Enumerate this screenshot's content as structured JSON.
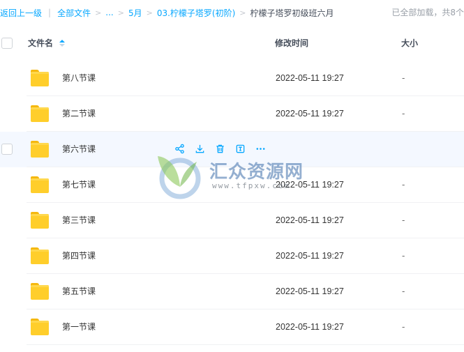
{
  "breadcrumb": {
    "back": "返回上一级",
    "items": [
      "全部文件",
      "...",
      "5月",
      "03.柠檬子塔罗(初阶)"
    ],
    "current": "柠檬子塔罗初级班六月",
    "status": "已全部加载，共8个"
  },
  "table": {
    "headers": {
      "name": "文件名",
      "time": "修改时间",
      "size": "大小"
    },
    "rows": [
      {
        "name": "第八节课",
        "time": "2022-05-11 19:27",
        "size": "-"
      },
      {
        "name": "第二节课",
        "time": "2022-05-11 19:27",
        "size": "-"
      },
      {
        "name": "第六节课",
        "time": "",
        "size": ""
      },
      {
        "name": "第七节课",
        "time": "2022-05-11 19:27",
        "size": "-"
      },
      {
        "name": "第三节课",
        "time": "2022-05-11 19:27",
        "size": "-"
      },
      {
        "name": "第四节课",
        "time": "2022-05-11 19:27",
        "size": "-"
      },
      {
        "name": "第五节课",
        "time": "2022-05-11 19:27",
        "size": "-"
      },
      {
        "name": "第一节课",
        "time": "2022-05-11 19:27",
        "size": "-"
      }
    ]
  },
  "hover_actions": [
    "share-icon",
    "download-icon",
    "delete-icon",
    "rename-icon",
    "more-icon"
  ],
  "watermark": {
    "title": "汇众资源网",
    "url": "www.tfpxw.com"
  },
  "colors": {
    "accent": "#06a7ff",
    "folder": "#ffce2b",
    "hover_row": "#f4f8ff"
  }
}
